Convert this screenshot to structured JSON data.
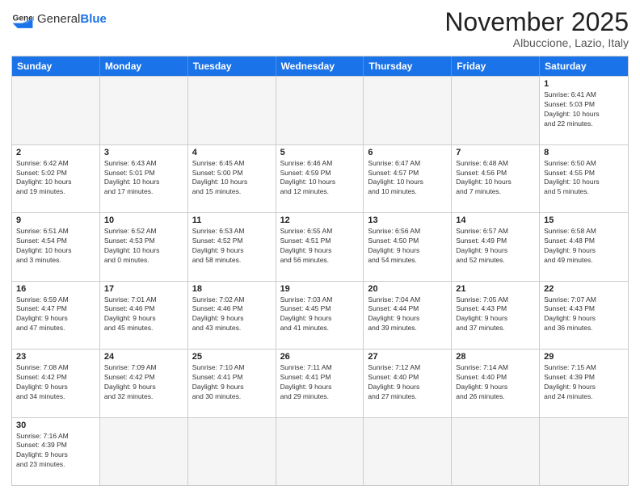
{
  "header": {
    "logo_general": "General",
    "logo_blue": "Blue",
    "month_title": "November 2025",
    "subtitle": "Albuccione, Lazio, Italy"
  },
  "days_of_week": [
    "Sunday",
    "Monday",
    "Tuesday",
    "Wednesday",
    "Thursday",
    "Friday",
    "Saturday"
  ],
  "weeks": [
    [
      {
        "day": "",
        "info": "",
        "empty": true
      },
      {
        "day": "",
        "info": "",
        "empty": true
      },
      {
        "day": "",
        "info": "",
        "empty": true
      },
      {
        "day": "",
        "info": "",
        "empty": true
      },
      {
        "day": "",
        "info": "",
        "empty": true
      },
      {
        "day": "",
        "info": "",
        "empty": true
      },
      {
        "day": "1",
        "info": "Sunrise: 6:41 AM\nSunset: 5:03 PM\nDaylight: 10 hours\nand 22 minutes.",
        "empty": false
      }
    ],
    [
      {
        "day": "2",
        "info": "Sunrise: 6:42 AM\nSunset: 5:02 PM\nDaylight: 10 hours\nand 19 minutes.",
        "empty": false
      },
      {
        "day": "3",
        "info": "Sunrise: 6:43 AM\nSunset: 5:01 PM\nDaylight: 10 hours\nand 17 minutes.",
        "empty": false
      },
      {
        "day": "4",
        "info": "Sunrise: 6:45 AM\nSunset: 5:00 PM\nDaylight: 10 hours\nand 15 minutes.",
        "empty": false
      },
      {
        "day": "5",
        "info": "Sunrise: 6:46 AM\nSunset: 4:59 PM\nDaylight: 10 hours\nand 12 minutes.",
        "empty": false
      },
      {
        "day": "6",
        "info": "Sunrise: 6:47 AM\nSunset: 4:57 PM\nDaylight: 10 hours\nand 10 minutes.",
        "empty": false
      },
      {
        "day": "7",
        "info": "Sunrise: 6:48 AM\nSunset: 4:56 PM\nDaylight: 10 hours\nand 7 minutes.",
        "empty": false
      },
      {
        "day": "8",
        "info": "Sunrise: 6:50 AM\nSunset: 4:55 PM\nDaylight: 10 hours\nand 5 minutes.",
        "empty": false
      }
    ],
    [
      {
        "day": "9",
        "info": "Sunrise: 6:51 AM\nSunset: 4:54 PM\nDaylight: 10 hours\nand 3 minutes.",
        "empty": false
      },
      {
        "day": "10",
        "info": "Sunrise: 6:52 AM\nSunset: 4:53 PM\nDaylight: 10 hours\nand 0 minutes.",
        "empty": false
      },
      {
        "day": "11",
        "info": "Sunrise: 6:53 AM\nSunset: 4:52 PM\nDaylight: 9 hours\nand 58 minutes.",
        "empty": false
      },
      {
        "day": "12",
        "info": "Sunrise: 6:55 AM\nSunset: 4:51 PM\nDaylight: 9 hours\nand 56 minutes.",
        "empty": false
      },
      {
        "day": "13",
        "info": "Sunrise: 6:56 AM\nSunset: 4:50 PM\nDaylight: 9 hours\nand 54 minutes.",
        "empty": false
      },
      {
        "day": "14",
        "info": "Sunrise: 6:57 AM\nSunset: 4:49 PM\nDaylight: 9 hours\nand 52 minutes.",
        "empty": false
      },
      {
        "day": "15",
        "info": "Sunrise: 6:58 AM\nSunset: 4:48 PM\nDaylight: 9 hours\nand 49 minutes.",
        "empty": false
      }
    ],
    [
      {
        "day": "16",
        "info": "Sunrise: 6:59 AM\nSunset: 4:47 PM\nDaylight: 9 hours\nand 47 minutes.",
        "empty": false
      },
      {
        "day": "17",
        "info": "Sunrise: 7:01 AM\nSunset: 4:46 PM\nDaylight: 9 hours\nand 45 minutes.",
        "empty": false
      },
      {
        "day": "18",
        "info": "Sunrise: 7:02 AM\nSunset: 4:46 PM\nDaylight: 9 hours\nand 43 minutes.",
        "empty": false
      },
      {
        "day": "19",
        "info": "Sunrise: 7:03 AM\nSunset: 4:45 PM\nDaylight: 9 hours\nand 41 minutes.",
        "empty": false
      },
      {
        "day": "20",
        "info": "Sunrise: 7:04 AM\nSunset: 4:44 PM\nDaylight: 9 hours\nand 39 minutes.",
        "empty": false
      },
      {
        "day": "21",
        "info": "Sunrise: 7:05 AM\nSunset: 4:43 PM\nDaylight: 9 hours\nand 37 minutes.",
        "empty": false
      },
      {
        "day": "22",
        "info": "Sunrise: 7:07 AM\nSunset: 4:43 PM\nDaylight: 9 hours\nand 36 minutes.",
        "empty": false
      }
    ],
    [
      {
        "day": "23",
        "info": "Sunrise: 7:08 AM\nSunset: 4:42 PM\nDaylight: 9 hours\nand 34 minutes.",
        "empty": false
      },
      {
        "day": "24",
        "info": "Sunrise: 7:09 AM\nSunset: 4:42 PM\nDaylight: 9 hours\nand 32 minutes.",
        "empty": false
      },
      {
        "day": "25",
        "info": "Sunrise: 7:10 AM\nSunset: 4:41 PM\nDaylight: 9 hours\nand 30 minutes.",
        "empty": false
      },
      {
        "day": "26",
        "info": "Sunrise: 7:11 AM\nSunset: 4:41 PM\nDaylight: 9 hours\nand 29 minutes.",
        "empty": false
      },
      {
        "day": "27",
        "info": "Sunrise: 7:12 AM\nSunset: 4:40 PM\nDaylight: 9 hours\nand 27 minutes.",
        "empty": false
      },
      {
        "day": "28",
        "info": "Sunrise: 7:14 AM\nSunset: 4:40 PM\nDaylight: 9 hours\nand 26 minutes.",
        "empty": false
      },
      {
        "day": "29",
        "info": "Sunrise: 7:15 AM\nSunset: 4:39 PM\nDaylight: 9 hours\nand 24 minutes.",
        "empty": false
      }
    ],
    [
      {
        "day": "30",
        "info": "Sunrise: 7:16 AM\nSunset: 4:39 PM\nDaylight: 9 hours\nand 23 minutes.",
        "empty": false
      },
      {
        "day": "",
        "info": "",
        "empty": true
      },
      {
        "day": "",
        "info": "",
        "empty": true
      },
      {
        "day": "",
        "info": "",
        "empty": true
      },
      {
        "day": "",
        "info": "",
        "empty": true
      },
      {
        "day": "",
        "info": "",
        "empty": true
      },
      {
        "day": "",
        "info": "",
        "empty": true
      }
    ]
  ]
}
